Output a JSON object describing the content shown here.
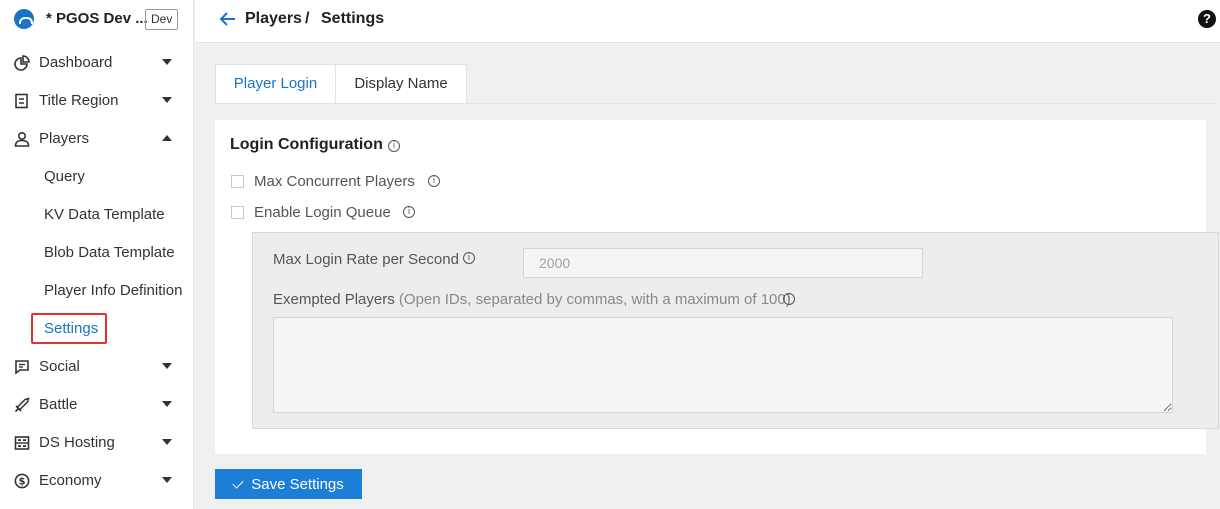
{
  "app": {
    "name": "* PGOS Dev ...",
    "env_badge": "Dev"
  },
  "sidebar": {
    "items": [
      {
        "label": "Dashboard",
        "icon": "dashboard-icon"
      },
      {
        "label": "Title Region",
        "icon": "document-icon"
      },
      {
        "label": "Players",
        "icon": "user-icon",
        "expanded": true
      },
      {
        "label": "Social",
        "icon": "chat-icon"
      },
      {
        "label": "Battle",
        "icon": "sword-icon"
      },
      {
        "label": "DS Hosting",
        "icon": "server-icon"
      },
      {
        "label": "Economy",
        "icon": "coin-icon"
      }
    ],
    "players_sub": [
      {
        "label": "Query"
      },
      {
        "label": "KV Data Template"
      },
      {
        "label": "Blob Data Template"
      },
      {
        "label": "Player Info Definition"
      },
      {
        "label": "Settings",
        "active": true
      }
    ]
  },
  "header": {
    "crumb_parent": "Players",
    "separator": "/",
    "crumb_current": "Settings",
    "help": "?"
  },
  "tabs": [
    {
      "label": "Player Login",
      "active": true
    },
    {
      "label": "Display Name"
    }
  ],
  "login_config": {
    "title": "Login Configuration",
    "max_concurrent_label": "Max Concurrent Players",
    "max_concurrent_checked": false,
    "enable_queue_label": "Enable Login Queue",
    "enable_queue_checked": false,
    "max_rate_label": "Max Login Rate per Second",
    "max_rate_value": "2000",
    "exempted_label": "Exempted Players",
    "exempted_hint": "(Open IDs, separated by commas, with a maximum of 100)",
    "exempted_value": ""
  },
  "save_button": "Save Settings",
  "colors": {
    "accent": "#1c7ed6",
    "highlight": "#e03131"
  }
}
